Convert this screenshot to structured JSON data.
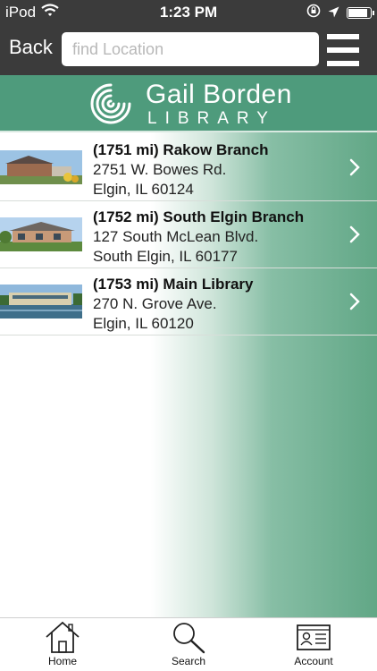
{
  "status_bar": {
    "carrier": "iPod",
    "time": "1:23 PM"
  },
  "nav": {
    "back_label": "Back",
    "search_placeholder": "find Location",
    "search_value": ""
  },
  "brand": {
    "name": "Gail Borden",
    "sub": "LIBRARY",
    "color": "#4e9b7c"
  },
  "locations": [
    {
      "name": "(1751 mi) Rakow Branch",
      "address1": "2751 W. Bowes Rd.",
      "address2": "Elgin, IL 60124"
    },
    {
      "name": "(1752 mi) South Elgin Branch",
      "address1": "127 South McLean Blvd.",
      "address2": "South Elgin, IL 60177"
    },
    {
      "name": "(1753 mi) Main Library",
      "address1": "270 N. Grove Ave.",
      "address2": "Elgin, IL 60120"
    }
  ],
  "tabs": [
    {
      "label": "Home",
      "icon": "home-icon"
    },
    {
      "label": "Search",
      "icon": "search-icon"
    },
    {
      "label": "Account",
      "icon": "account-card-icon"
    }
  ],
  "battery_level": 0.9
}
